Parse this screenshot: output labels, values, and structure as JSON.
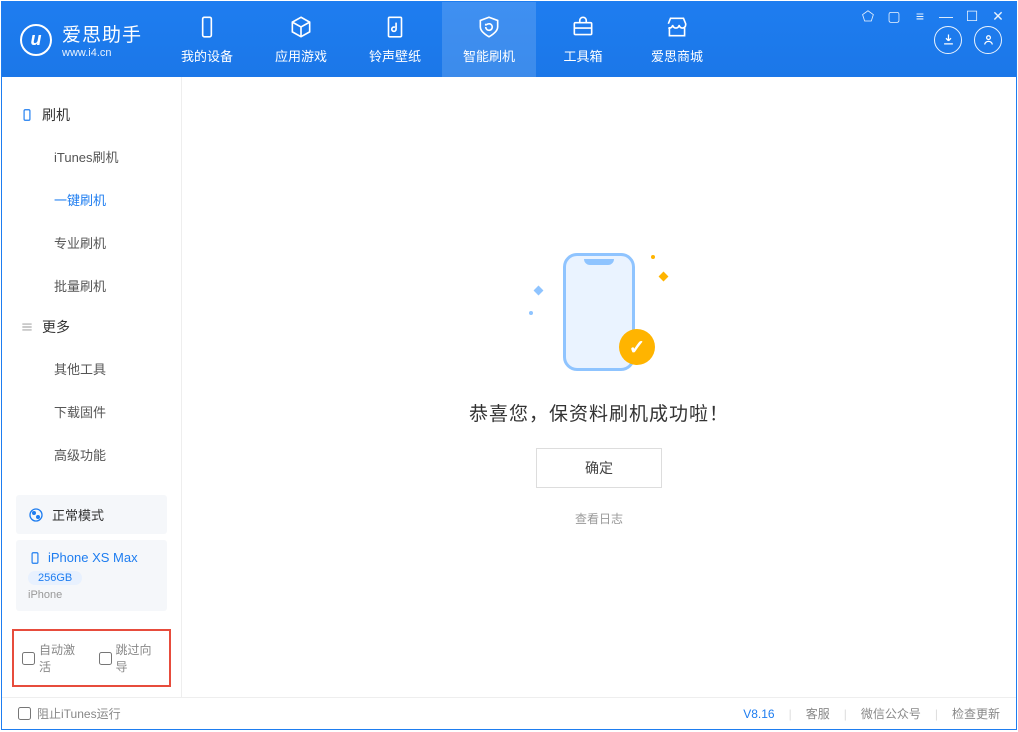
{
  "brand": {
    "name_cn": "爱思助手",
    "name_en": "www.i4.cn"
  },
  "tabs": [
    {
      "label": "我的设备"
    },
    {
      "label": "应用游戏"
    },
    {
      "label": "铃声壁纸"
    },
    {
      "label": "智能刷机"
    },
    {
      "label": "工具箱"
    },
    {
      "label": "爱思商城"
    }
  ],
  "sidebar": {
    "section1_title": "刷机",
    "items1": [
      {
        "label": "iTunes刷机"
      },
      {
        "label": "一键刷机"
      },
      {
        "label": "专业刷机"
      },
      {
        "label": "批量刷机"
      }
    ],
    "section2_title": "更多",
    "items2": [
      {
        "label": "其他工具"
      },
      {
        "label": "下载固件"
      },
      {
        "label": "高级功能"
      }
    ],
    "status_mode": "正常模式",
    "device": {
      "name": "iPhone XS Max",
      "storage": "256GB",
      "type": "iPhone"
    },
    "check_auto_activate": "自动激活",
    "check_skip_guide": "跳过向导"
  },
  "main": {
    "success_msg": "恭喜您，保资料刷机成功啦！",
    "ok_label": "确定",
    "view_log": "查看日志"
  },
  "footer": {
    "block_itunes": "阻止iTunes运行",
    "version": "V8.16",
    "support": "客服",
    "wechat": "微信公众号",
    "check_update": "检查更新"
  }
}
